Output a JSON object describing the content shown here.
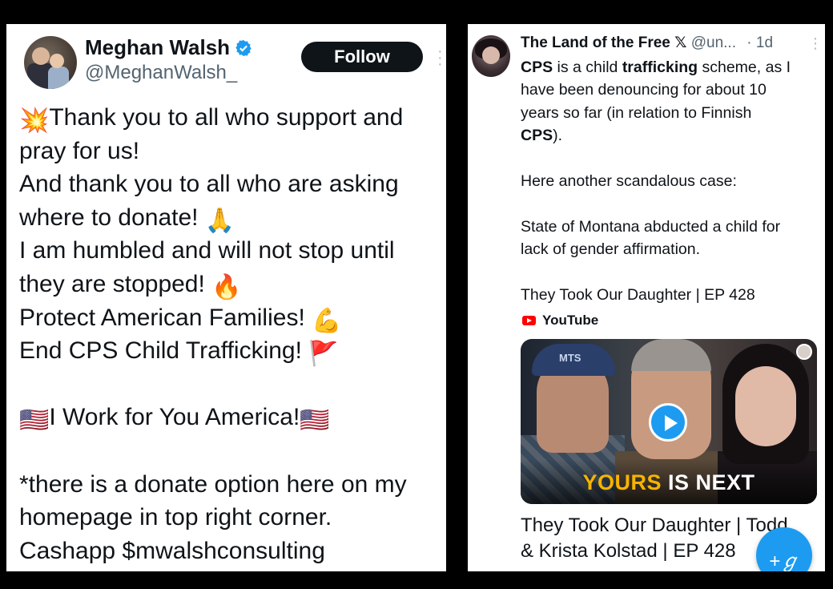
{
  "left_tweet": {
    "display_name": "Meghan Walsh",
    "handle": "@MeghanWalsh_",
    "follow_label": "Follow",
    "verified_icon": "verified-badge-icon",
    "lines": [
      {
        "emoji": "💥",
        "text": "Thank you to all who support and"
      },
      {
        "text": "pray for us!"
      },
      {
        "text": "And thank you to all who are asking"
      },
      {
        "text": "where to donate! ",
        "emoji_after": "🙏"
      },
      {
        "text": "I am humbled and will not stop until"
      },
      {
        "text": "they are stopped! ",
        "emoji_after": "🔥"
      },
      {
        "text": "Protect American Families! ",
        "emoji_after": "💪"
      },
      {
        "text": "End CPS Child Trafficking! ",
        "emoji_after": "🚩"
      },
      {
        "gap": true
      },
      {
        "emoji": "🇺🇸",
        "text": "I Work for You America!",
        "emoji_after": "🇺🇸"
      },
      {
        "gap": true
      },
      {
        "text": "*there is a donate option here on my"
      },
      {
        "text": "homepage in top right corner."
      },
      {
        "text": "Cashapp $mwalshconsulting"
      }
    ]
  },
  "right_tweet": {
    "display_name": "The Land of the Free",
    "x_mark": "𝕏",
    "handle": "@un...",
    "age": "· 1d",
    "more_icon": "more-dots-icon",
    "lines": [
      {
        "html_bold": [
          "CPS"
        ],
        "text": "CPS is a child trafficking scheme, as I"
      },
      {
        "text": "have been denouncing for about 10"
      },
      {
        "text": "years so far (in relation to Finnish"
      },
      {
        "text": "CPS)."
      },
      {
        "gap": true
      },
      {
        "text": "Here another scandalous case:"
      },
      {
        "gap": true
      },
      {
        "text": "State of Montana abducted a child for"
      },
      {
        "text": "lack of gender affirmation."
      },
      {
        "gap": true
      },
      {
        "text": "They Took Our Daughter | EP 428"
      }
    ],
    "link_source": "YouTube",
    "thumbnail": {
      "cap_text": "MTS",
      "caption_highlight": "YOURS",
      "caption_rest": " IS NEXT"
    },
    "link_title_line1": "They Took Our Daughter | Todd",
    "link_title_line2": "& Krista Kolstad | EP 428",
    "compose_icon": "compose-feather-icon",
    "compose_glyph": "+ℊ"
  },
  "colors": {
    "accent": "#1d9bf0",
    "text_primary": "#0f1419",
    "text_secondary": "#536471",
    "youtube_red": "#ff0000",
    "caption_yellow": "#f5b400"
  }
}
